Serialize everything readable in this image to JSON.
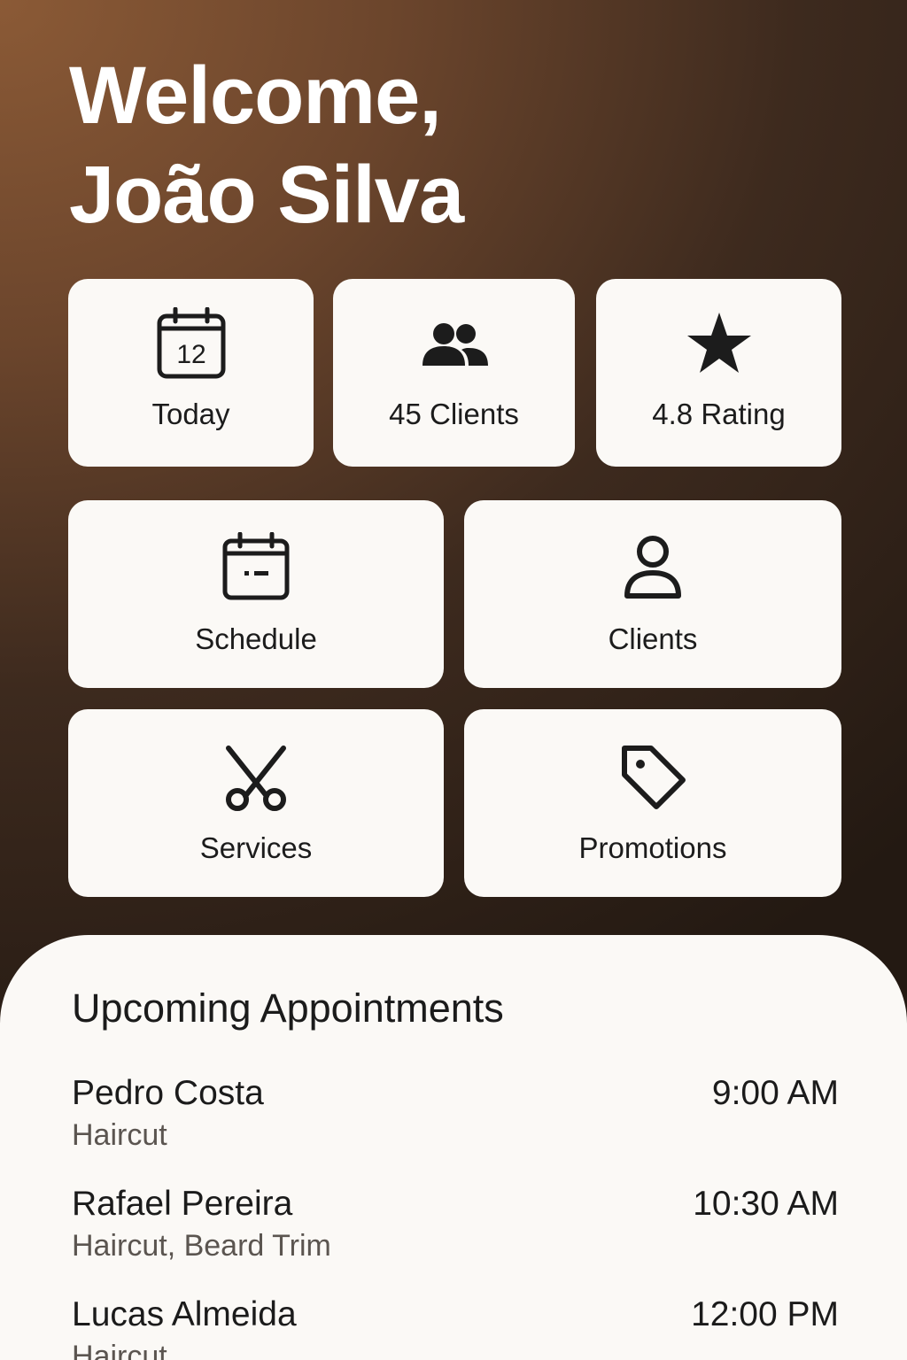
{
  "header": {
    "greeting_line1": "Welcome,",
    "greeting_line2": "João Silva"
  },
  "stats": {
    "today": {
      "label": "Today",
      "calendar_day": "12",
      "icon": "calendar-icon"
    },
    "clients": {
      "label": "45 Clients",
      "icon": "users-icon"
    },
    "rating": {
      "label": "4.8 Rating",
      "icon": "star-icon"
    }
  },
  "actions": {
    "schedule": {
      "label": "Schedule",
      "icon": "calendar-icon"
    },
    "clients": {
      "label": "Clients",
      "icon": "user-icon"
    },
    "services": {
      "label": "Services",
      "icon": "scissors-icon"
    },
    "promotions": {
      "label": "Promotions",
      "icon": "tag-icon"
    }
  },
  "appointments": {
    "title": "Upcoming Appointments",
    "items": [
      {
        "name": "Pedro Costa",
        "service": "Haircut",
        "time": "9:00 AM"
      },
      {
        "name": "Rafael Pereira",
        "service": "Haircut, Beard Trim",
        "time": "10:30 AM"
      },
      {
        "name": "Lucas Almeida",
        "service": "Haircut",
        "time": "12:00 PM"
      }
    ]
  },
  "colors": {
    "background_top": "#8b5a36",
    "background_bottom": "#231912",
    "card": "#fbf9f6",
    "text": "#1b1b1b",
    "secondary_text": "#5b5550"
  }
}
